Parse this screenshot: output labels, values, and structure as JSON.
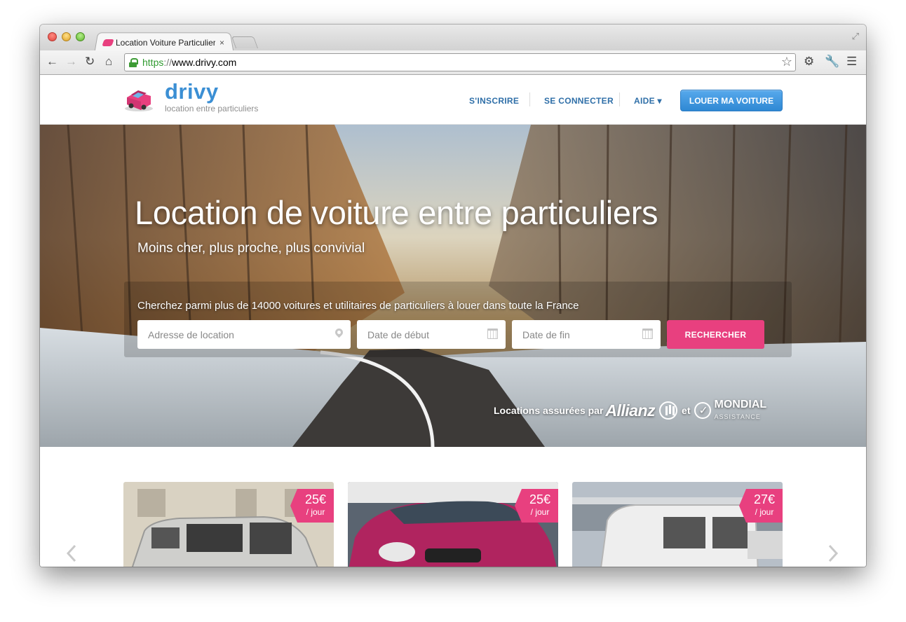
{
  "browser": {
    "tab_title": "Location Voiture Particuliers",
    "tab_close": "×",
    "url_scheme": "https",
    "url_sep": "://",
    "url_host": "www.drivy.com"
  },
  "header": {
    "brand": "drivy",
    "tagline": "location entre particuliers",
    "nav": {
      "signup": "S'INSCRIRE",
      "login": "SE CONNECTER",
      "help": "AIDE ▾"
    },
    "cta": "LOUER MA VOITURE"
  },
  "hero": {
    "title": "Location de voiture entre particuliers",
    "subtitle": "Moins cher, plus proche, plus convivial",
    "search_intro": "Cherchez parmi plus de 14000 voitures et utilitaires de particuliers à louer dans toute la France",
    "address_placeholder": "Adresse de location",
    "start_placeholder": "Date de début",
    "end_placeholder": "Date de fin",
    "search_button": "RECHERCHER",
    "insurance": {
      "text": "Locations assurées par",
      "allianz": "Allianz",
      "and": "et",
      "mondial": "MONDIAL",
      "mondial_sub": "ASSISTANCE"
    }
  },
  "cars": [
    {
      "price": "25€",
      "unit": "/ jour",
      "color": "#c9c9c7"
    },
    {
      "price": "25€",
      "unit": "/ jour",
      "color": "#b0245f"
    },
    {
      "price": "27€",
      "unit": "/ jour",
      "color": "#eeeeee"
    }
  ],
  "colors": {
    "brand_blue": "#3b8fd4",
    "accent_pink": "#e8407f",
    "nav_blue": "#2f6fa8"
  }
}
